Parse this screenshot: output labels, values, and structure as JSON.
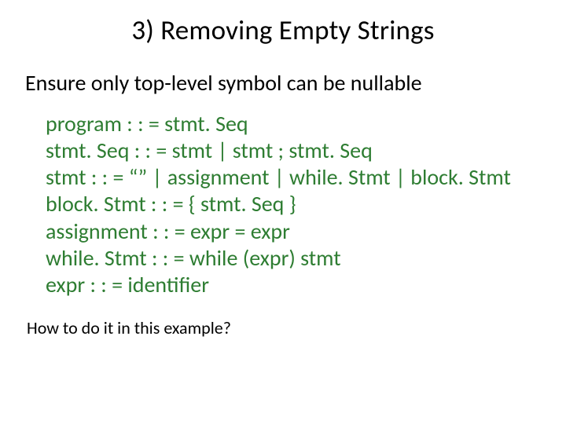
{
  "title": "3) Removing Empty Strings",
  "subtitle": "Ensure only top-level symbol can be nullable",
  "grammar": {
    "l1": "program : : = stmt. Seq",
    "l2": "stmt. Seq : : = stmt | stmt ; stmt. Seq",
    "l3": "stmt : : = “” | assignment | while. Stmt | block. Stmt",
    "l4": "block. Stmt : : = { stmt. Seq }",
    "l5": "assignment : : = expr = expr",
    "l6": "while. Stmt : : = while (expr) stmt",
    "l7": "expr : : = identifier"
  },
  "question": "How to do it in this example?",
  "colors": {
    "grammar_text": "#2E7D32",
    "body_text": "#000000"
  }
}
